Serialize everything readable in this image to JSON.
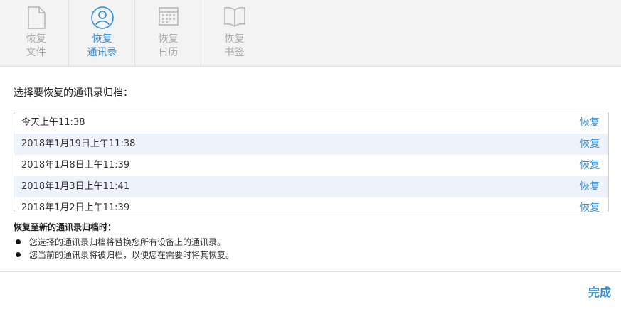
{
  "tabs": [
    {
      "line1": "恢复",
      "line2": "文件",
      "icon": "file-icon",
      "active": false
    },
    {
      "line1": "恢复",
      "line2": "通讯录",
      "icon": "contacts-icon",
      "active": true
    },
    {
      "line1": "恢复",
      "line2": "日历",
      "icon": "calendar-icon",
      "active": false
    },
    {
      "line1": "恢复",
      "line2": "书签",
      "icon": "bookmarks-icon",
      "active": false
    }
  ],
  "heading": "选择要恢复的通讯录归档：",
  "archives": [
    {
      "date": "今天上午11:38",
      "action": "恢复"
    },
    {
      "date": "2018年1月19日上午11:38",
      "action": "恢复"
    },
    {
      "date": "2018年1月8日上午11:39",
      "action": "恢复"
    },
    {
      "date": "2018年1月3日上午11:41",
      "action": "恢复"
    },
    {
      "date": "2018年1月2日上午11:39",
      "action": "恢复"
    }
  ],
  "notes": {
    "title": "恢复至新的通讯录归档时：",
    "items": [
      "您选择的通讯录归档将替换您所有设备上的通讯录。",
      "您当前的通讯录将被归档，以便您在需要时将其恢复。"
    ]
  },
  "footer": {
    "done_label": "完成"
  },
  "colors": {
    "accent": "#2f8fd9",
    "inactive": "#a9a9a9",
    "alt_row": "#eef3fb"
  }
}
